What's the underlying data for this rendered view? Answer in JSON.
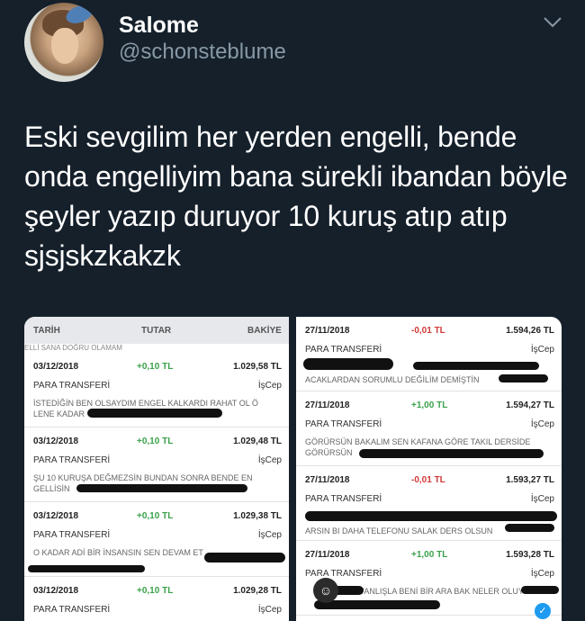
{
  "author": {
    "name": "Salome",
    "handle": "@schonsteblume"
  },
  "tweet": {
    "text": "Eski sevgilim her yerden engelli, bende onda engelliyim bana sürekli ibandan böyle şeyler yazıp duruyor 10 kuruş atıp atıp sjsjskzkakzk"
  },
  "statement_left": {
    "headers": {
      "date": "TARİH",
      "amount": "TUTAR",
      "balance": "BAKİYE"
    },
    "cut_line": "ELLİ SANA DOĞRU OLAMAM",
    "rows": [
      {
        "date": "03/12/2018",
        "amount": "+0,10 TL",
        "balance": "1.029,58 TL",
        "type": "PARA TRANSFERİ",
        "source": "İşCep",
        "desc": "İSTEDİĞİN BEN OLSAYDIM ENGEL KALKARDI RAHAT OL Ö LENE KADAR"
      },
      {
        "date": "03/12/2018",
        "amount": "+0,10 TL",
        "balance": "1.029,48 TL",
        "type": "PARA TRANSFERİ",
        "source": "İşCep",
        "desc": "ŞU 10 KURUŞA DEĞMEZSİN BUNDAN SONRA BENDE EN GELLİSİN"
      },
      {
        "date": "03/12/2018",
        "amount": "+0,10 TL",
        "balance": "1.029,38 TL",
        "type": "PARA TRANSFERİ",
        "source": "İşCep",
        "desc": "O KADAR ADİ BİR İNSANSIN SEN DEVAM ET"
      },
      {
        "date": "03/12/2018",
        "amount": "+0,10 TL",
        "balance": "1.029,28 TL",
        "type": "PARA TRANSFERİ",
        "source": "İşCep",
        "desc": ""
      }
    ]
  },
  "statement_right": {
    "rows": [
      {
        "date": "27/11/2018",
        "amount": "-0,01 TL",
        "balance": "1.594,26 TL",
        "type": "PARA TRANSFERİ",
        "source": "İşCep",
        "desc": "ACAKLARDAN SORUMLU DEĞİLİM DEMİŞTİN",
        "dir": "neg"
      },
      {
        "date": "27/11/2018",
        "amount": "+1,00 TL",
        "balance": "1.594,27 TL",
        "type": "PARA TRANSFERİ",
        "source": "İşCep",
        "desc": "GÖRÜRSÜN BAKALIM SEN KAFANA GÖRE TAKIL DERSİDE GÖRÜRSÜN",
        "dir": "pos"
      },
      {
        "date": "27/11/2018",
        "amount": "-0,01 TL",
        "balance": "1.593,27 TL",
        "type": "PARA TRANSFERİ",
        "source": "İşCep",
        "desc": "ARSIN BI DAHA TELEFONU SALAK DERS OLSUN",
        "dir": "neg"
      },
      {
        "date": "27/11/2018",
        "amount": "+1,00 TL",
        "balance": "1.593,28 TL",
        "type": "PARA TRANSFERİ",
        "source": "İşCep",
        "desc": "YANLIŞLA BENİ BİR ARA BAK NELER OLUYOR",
        "dir": "pos"
      }
    ]
  },
  "colors": {
    "background": "#15202b",
    "positive": "#3aa14a",
    "negative": "#d13a3a",
    "accent": "#1d9bf0"
  },
  "icons": {
    "more": "chevron-down-icon",
    "camera": "camera-icon",
    "check": "check-icon"
  }
}
